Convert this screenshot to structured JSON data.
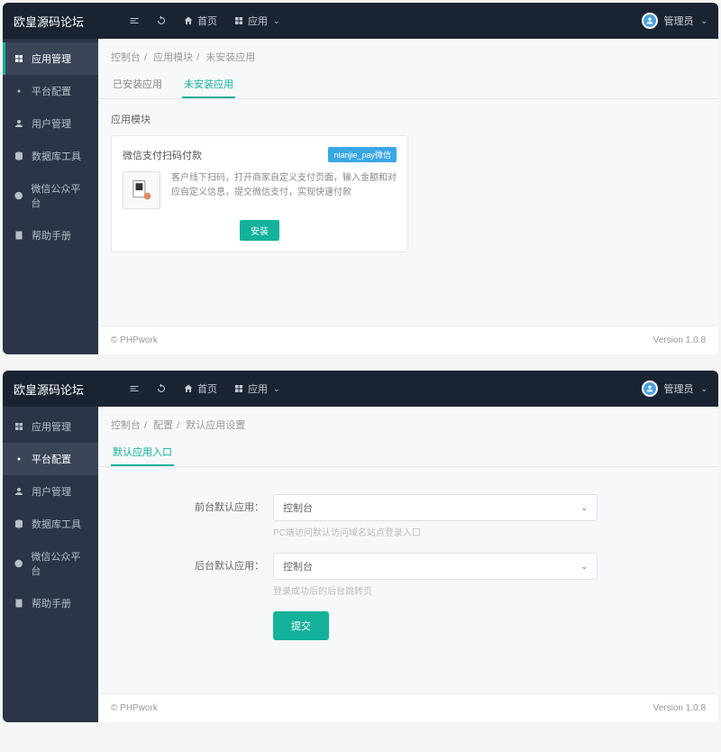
{
  "brand": "欧皇源码论坛",
  "topbar": {
    "home": "首页",
    "apps": "应用"
  },
  "user": "管理员",
  "sidebar": [
    {
      "label": "应用管理",
      "key": "apps"
    },
    {
      "label": "平台配置",
      "key": "platform"
    },
    {
      "label": "用户管理",
      "key": "users"
    },
    {
      "label": "数据库工具",
      "key": "db"
    },
    {
      "label": "微信公众平台",
      "key": "wechat"
    },
    {
      "label": "帮助手册",
      "key": "help"
    }
  ],
  "screen1": {
    "breadcrumb": [
      "控制台",
      "应用模块",
      "未安装应用"
    ],
    "tabs": [
      "已安装应用",
      "未安装应用"
    ],
    "section": "应用模块",
    "card": {
      "title": "微信支付扫码付款",
      "badge": "nianjie_pay微信",
      "desc": "客户线下扫码，打开商家自定义支付页面，输入金额和对应自定义信息，提交微信支付，实现快速付款",
      "install": "安装"
    }
  },
  "screen2": {
    "breadcrumb": [
      "控制台",
      "配置",
      "默认应用设置"
    ],
    "tab": "默认应用入口",
    "form": {
      "field1_label": "前台默认应用：",
      "field1_value": "控制台",
      "field1_hint": "PC端访问默认访问域名站点登录入口",
      "field2_label": "后台默认应用：",
      "field2_value": "控制台",
      "field2_hint": "登录成功后的后台跳转页",
      "submit": "提交"
    }
  },
  "footer": {
    "left": "© PHPwork",
    "right": "Version 1.0.8"
  }
}
